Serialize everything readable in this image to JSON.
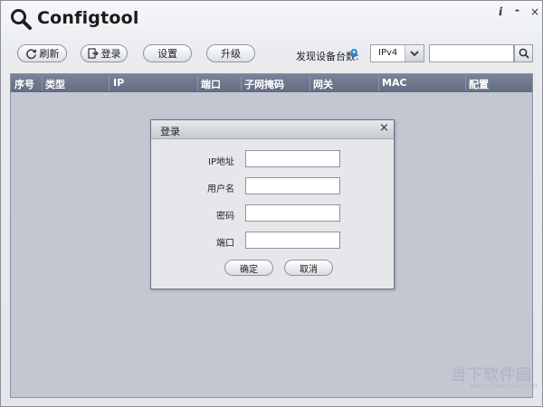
{
  "app": {
    "title": "Configtool"
  },
  "window_controls": {
    "info": "i",
    "minimize": "-",
    "close": "×"
  },
  "toolbar": {
    "refresh_label": "刷新",
    "login_label": "登录",
    "settings_label": "设置",
    "upgrade_label": "升级",
    "found_label": "发现设备台数:",
    "found_count": "0",
    "ip_version": "IPv4",
    "search_value": ""
  },
  "table": {
    "columns": [
      "序号",
      "类型",
      "IP",
      "端口",
      "子网掩码",
      "网关",
      "MAC",
      "配置"
    ]
  },
  "dialog": {
    "title": "登录",
    "close": "×",
    "fields": {
      "ip_label": "IP地址",
      "username_label": "用户名",
      "password_label": "密码",
      "port_label": "端口"
    },
    "values": {
      "ip": "",
      "username": "",
      "password": "",
      "port": ""
    },
    "ok_label": "确定",
    "cancel_label": "取消"
  },
  "watermark": {
    "text": "当下软件园",
    "url": "www.downxia.com"
  },
  "colors": {
    "header_bg": "#6b758b",
    "table_bg": "#c2c7d2",
    "count_color": "#1a86d6"
  }
}
